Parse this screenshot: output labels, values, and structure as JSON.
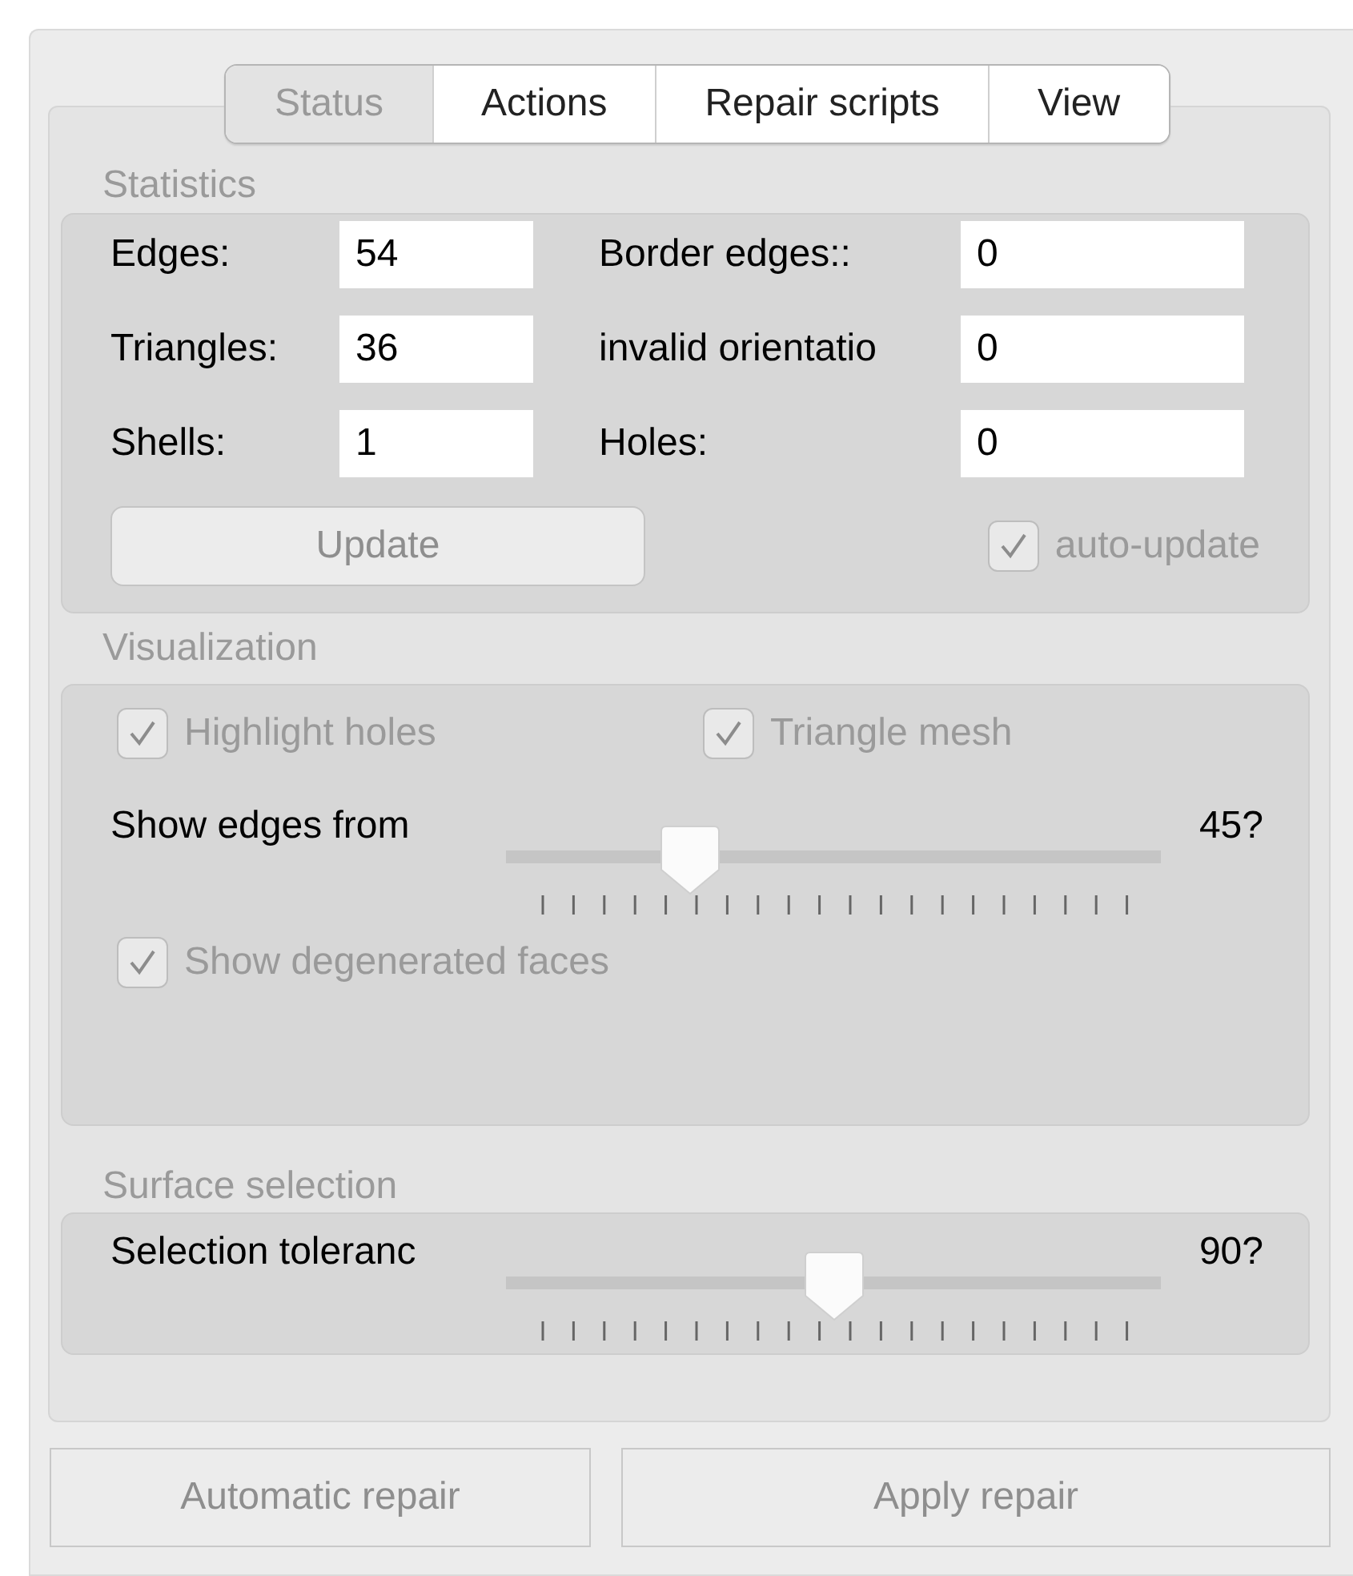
{
  "tabs": [
    {
      "label": "Status",
      "selected": true
    },
    {
      "label": "Actions",
      "selected": false
    },
    {
      "label": "Repair scripts",
      "selected": false
    },
    {
      "label": "View",
      "selected": false
    }
  ],
  "statistics": {
    "title": "Statistics",
    "fields": [
      {
        "label": "Edges:",
        "value": "54"
      },
      {
        "label": "Border edges::",
        "value": "0"
      },
      {
        "label": "Triangles:",
        "value": "36"
      },
      {
        "label": "invalid orientatio",
        "value": "0"
      },
      {
        "label": "Shells:",
        "value": "1"
      },
      {
        "label": "Holes:",
        "value": "0"
      }
    ],
    "update_button": {
      "label": "Update",
      "disabled": true
    },
    "auto_update": {
      "label": "auto-update",
      "checked": true,
      "disabled": true
    }
  },
  "visualization": {
    "title": "Visualization",
    "highlight_holes": {
      "label": "Highlight holes",
      "checked": true,
      "disabled": true
    },
    "triangle_mesh": {
      "label": "Triangle mesh",
      "checked": true,
      "disabled": true
    },
    "edges_slider": {
      "label": "Show edges from",
      "level": 0.28,
      "reading": "45?"
    },
    "degenerated_faces": {
      "label": "Show degenerated faces",
      "checked": true,
      "disabled": true
    }
  },
  "surface_selection": {
    "title": "Surface selection",
    "slider": {
      "label": "Selection toleranc",
      "level": 0.5,
      "reading": "90?"
    }
  },
  "buttons": [
    {
      "label": "Automatic repair",
      "disabled": true
    },
    {
      "label": "Apply repair",
      "disabled": true
    }
  ]
}
